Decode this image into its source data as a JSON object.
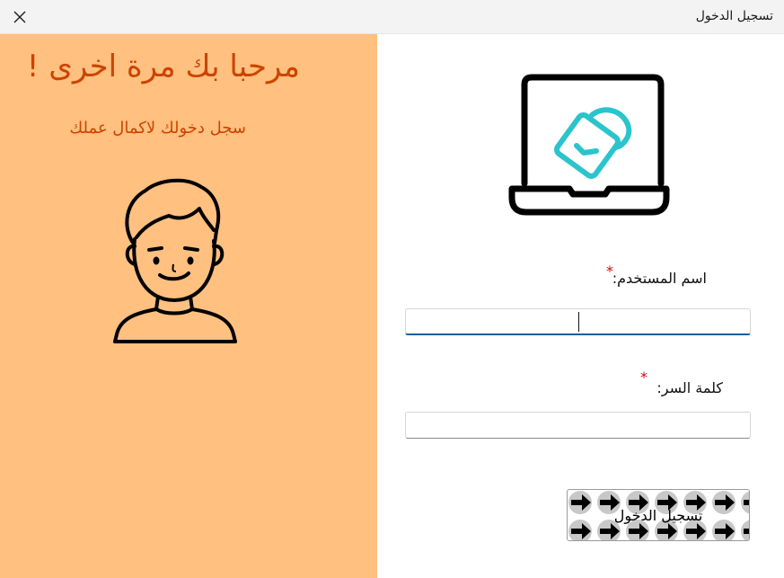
{
  "window": {
    "title": "تسجيل الدخول",
    "close_icon": "close-icon"
  },
  "welcome": {
    "title": "مرحبا بك مرة اخرى !",
    "subtitle": "سجل دخولك لاكمال عملك"
  },
  "form": {
    "username_label": "اسم المستخدم:",
    "password_label": "كلمة السر:",
    "required_marker": "*",
    "username_value": "",
    "password_value": "",
    "login_button": "تسجيل الدخول"
  },
  "icons": {
    "avatar": "user-avatar-icon",
    "laptop": "laptop-lock-icon",
    "button_pattern": "arrow-right-icon"
  },
  "colors": {
    "panel_background": "#ffc080",
    "welcome_text": "#cc4400",
    "required": "#e00000",
    "accent": "#1a5e9c",
    "lock": "#2bc4cc"
  }
}
